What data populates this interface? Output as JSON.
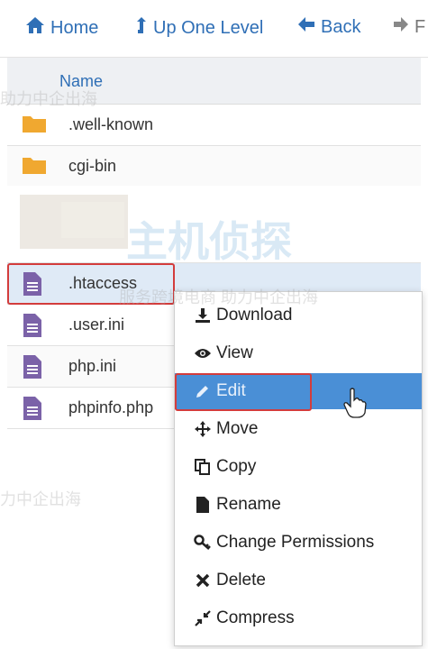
{
  "toolbar": {
    "home": "Home",
    "up": "Up One Level",
    "back": "Back",
    "forward": "F"
  },
  "header": {
    "name": "Name"
  },
  "files": [
    {
      "name": ".well-known",
      "type": "folder"
    },
    {
      "name": "cgi-bin",
      "type": "folder"
    },
    {
      "name": ".htaccess",
      "type": "file"
    },
    {
      "name": ".user.ini",
      "type": "file"
    },
    {
      "name": "php.ini",
      "type": "file"
    },
    {
      "name": "phpinfo.php",
      "type": "file"
    }
  ],
  "context_menu": [
    {
      "label": "Download",
      "icon": "download-icon"
    },
    {
      "label": "View",
      "icon": "eye-icon"
    },
    {
      "label": "Edit",
      "icon": "pencil-icon"
    },
    {
      "label": "Move",
      "icon": "move-icon"
    },
    {
      "label": "Copy",
      "icon": "copy-icon"
    },
    {
      "label": "Rename",
      "icon": "file-icon"
    },
    {
      "label": "Change Permissions",
      "icon": "key-icon"
    },
    {
      "label": "Delete",
      "icon": "x-icon"
    },
    {
      "label": "Compress",
      "icon": "compress-icon"
    }
  ],
  "watermarks": {
    "line1": "服务跨境电商  助力中企出海",
    "line2": "助力中企出海",
    "line3": "服务跨境电商  助力中企出海",
    "line4": "力中企出海",
    "logo": "主机侦探"
  },
  "colors": {
    "link": "#2f6fb6",
    "folder": "#f0a830",
    "file": "#7b62a8",
    "highlight": "#d33c3c",
    "menu_active": "#4a8fd6"
  }
}
